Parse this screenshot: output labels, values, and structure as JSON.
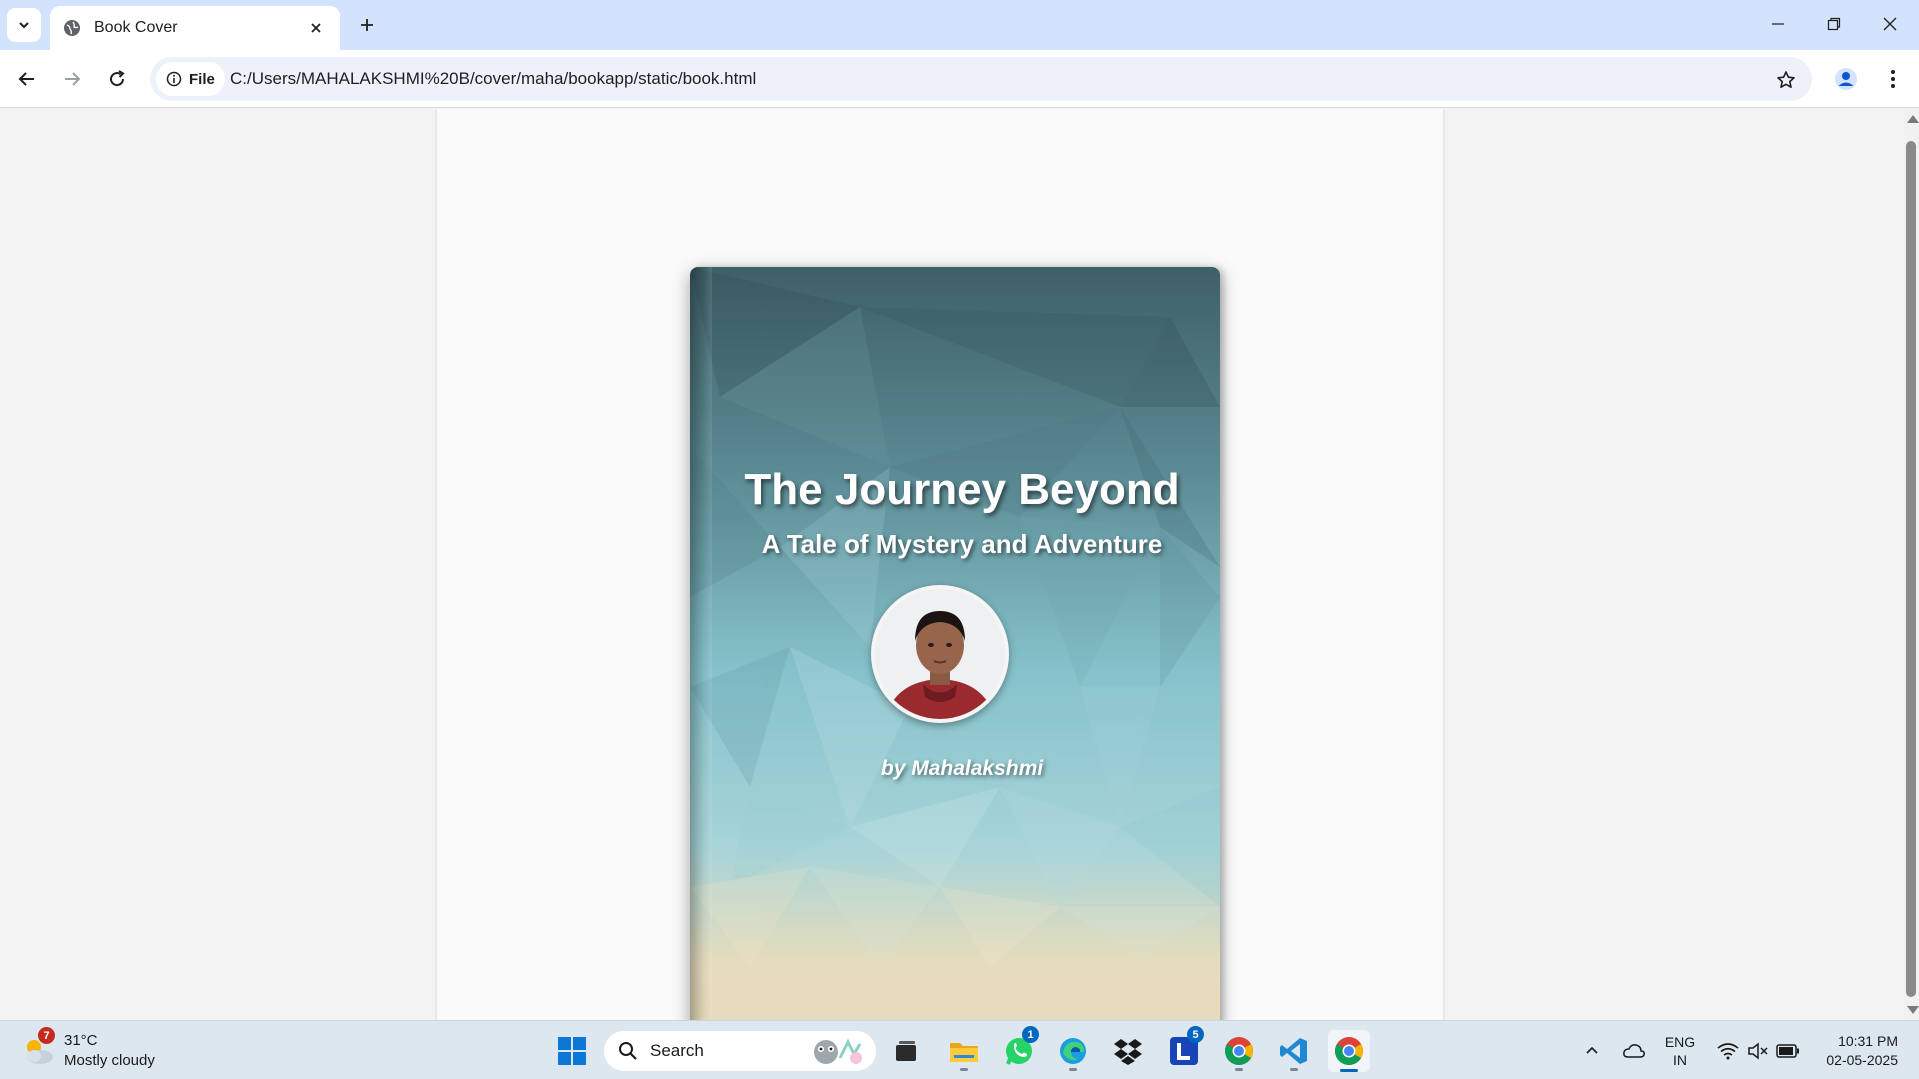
{
  "browser": {
    "tab_title": "Book Cover",
    "site_chip_label": "File",
    "url": "C:/Users/MAHALAKSHMI%20B/cover/maha/bookapp/static/book.html"
  },
  "book": {
    "title": "The Journey Beyond",
    "subtitle": "A Tale of Mystery and Adventure",
    "author": "by Mahalakshmi"
  },
  "taskbar": {
    "weather": {
      "temperature": "31°C",
      "condition": "Mostly cloudy",
      "badge": "7"
    },
    "search_label": "Search",
    "whatsapp_badge": "1",
    "l_app_badge": "5",
    "language": {
      "line1": "ENG",
      "line2": "IN"
    },
    "time": "10:31 PM",
    "date": "02-05-2025"
  },
  "colors": {
    "tabstrip": "#d3e3fd",
    "book_top": "#3e5f68",
    "book_mid": "#8cc6cf",
    "book_bottom": "#eadcbd",
    "accent": "#0067c0"
  }
}
